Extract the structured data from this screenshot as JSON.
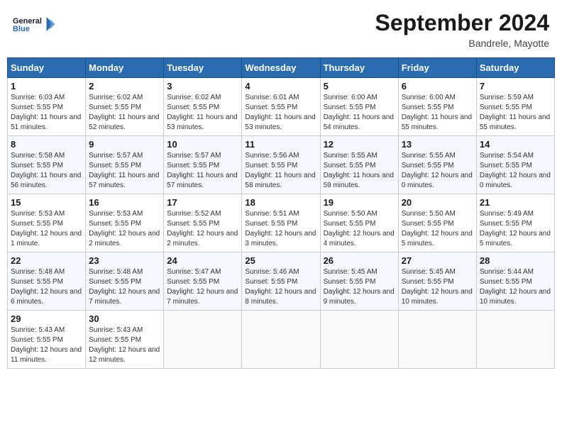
{
  "header": {
    "logo_line1": "General",
    "logo_line2": "Blue",
    "month_year": "September 2024",
    "location": "Bandrele, Mayotte"
  },
  "days_of_week": [
    "Sunday",
    "Monday",
    "Tuesday",
    "Wednesday",
    "Thursday",
    "Friday",
    "Saturday"
  ],
  "weeks": [
    [
      {
        "day": "1",
        "sunrise": "6:03 AM",
        "sunset": "5:55 PM",
        "daylight": "11 hours and 51 minutes."
      },
      {
        "day": "2",
        "sunrise": "6:02 AM",
        "sunset": "5:55 PM",
        "daylight": "11 hours and 52 minutes."
      },
      {
        "day": "3",
        "sunrise": "6:02 AM",
        "sunset": "5:55 PM",
        "daylight": "11 hours and 53 minutes."
      },
      {
        "day": "4",
        "sunrise": "6:01 AM",
        "sunset": "5:55 PM",
        "daylight": "11 hours and 53 minutes."
      },
      {
        "day": "5",
        "sunrise": "6:00 AM",
        "sunset": "5:55 PM",
        "daylight": "11 hours and 54 minutes."
      },
      {
        "day": "6",
        "sunrise": "6:00 AM",
        "sunset": "5:55 PM",
        "daylight": "11 hours and 55 minutes."
      },
      {
        "day": "7",
        "sunrise": "5:59 AM",
        "sunset": "5:55 PM",
        "daylight": "11 hours and 55 minutes."
      }
    ],
    [
      {
        "day": "8",
        "sunrise": "5:58 AM",
        "sunset": "5:55 PM",
        "daylight": "11 hours and 56 minutes."
      },
      {
        "day": "9",
        "sunrise": "5:57 AM",
        "sunset": "5:55 PM",
        "daylight": "11 hours and 57 minutes."
      },
      {
        "day": "10",
        "sunrise": "5:57 AM",
        "sunset": "5:55 PM",
        "daylight": "11 hours and 57 minutes."
      },
      {
        "day": "11",
        "sunrise": "5:56 AM",
        "sunset": "5:55 PM",
        "daylight": "11 hours and 58 minutes."
      },
      {
        "day": "12",
        "sunrise": "5:55 AM",
        "sunset": "5:55 PM",
        "daylight": "11 hours and 59 minutes."
      },
      {
        "day": "13",
        "sunrise": "5:55 AM",
        "sunset": "5:55 PM",
        "daylight": "12 hours and 0 minutes."
      },
      {
        "day": "14",
        "sunrise": "5:54 AM",
        "sunset": "5:55 PM",
        "daylight": "12 hours and 0 minutes."
      }
    ],
    [
      {
        "day": "15",
        "sunrise": "5:53 AM",
        "sunset": "5:55 PM",
        "daylight": "12 hours and 1 minute."
      },
      {
        "day": "16",
        "sunrise": "5:53 AM",
        "sunset": "5:55 PM",
        "daylight": "12 hours and 2 minutes."
      },
      {
        "day": "17",
        "sunrise": "5:52 AM",
        "sunset": "5:55 PM",
        "daylight": "12 hours and 2 minutes."
      },
      {
        "day": "18",
        "sunrise": "5:51 AM",
        "sunset": "5:55 PM",
        "daylight": "12 hours and 3 minutes."
      },
      {
        "day": "19",
        "sunrise": "5:50 AM",
        "sunset": "5:55 PM",
        "daylight": "12 hours and 4 minutes."
      },
      {
        "day": "20",
        "sunrise": "5:50 AM",
        "sunset": "5:55 PM",
        "daylight": "12 hours and 5 minutes."
      },
      {
        "day": "21",
        "sunrise": "5:49 AM",
        "sunset": "5:55 PM",
        "daylight": "12 hours and 5 minutes."
      }
    ],
    [
      {
        "day": "22",
        "sunrise": "5:48 AM",
        "sunset": "5:55 PM",
        "daylight": "12 hours and 6 minutes."
      },
      {
        "day": "23",
        "sunrise": "5:48 AM",
        "sunset": "5:55 PM",
        "daylight": "12 hours and 7 minutes."
      },
      {
        "day": "24",
        "sunrise": "5:47 AM",
        "sunset": "5:55 PM",
        "daylight": "12 hours and 7 minutes."
      },
      {
        "day": "25",
        "sunrise": "5:46 AM",
        "sunset": "5:55 PM",
        "daylight": "12 hours and 8 minutes."
      },
      {
        "day": "26",
        "sunrise": "5:45 AM",
        "sunset": "5:55 PM",
        "daylight": "12 hours and 9 minutes."
      },
      {
        "day": "27",
        "sunrise": "5:45 AM",
        "sunset": "5:55 PM",
        "daylight": "12 hours and 10 minutes."
      },
      {
        "day": "28",
        "sunrise": "5:44 AM",
        "sunset": "5:55 PM",
        "daylight": "12 hours and 10 minutes."
      }
    ],
    [
      {
        "day": "29",
        "sunrise": "5:43 AM",
        "sunset": "5:55 PM",
        "daylight": "12 hours and 11 minutes."
      },
      {
        "day": "30",
        "sunrise": "5:43 AM",
        "sunset": "5:55 PM",
        "daylight": "12 hours and 12 minutes."
      },
      null,
      null,
      null,
      null,
      null
    ]
  ]
}
